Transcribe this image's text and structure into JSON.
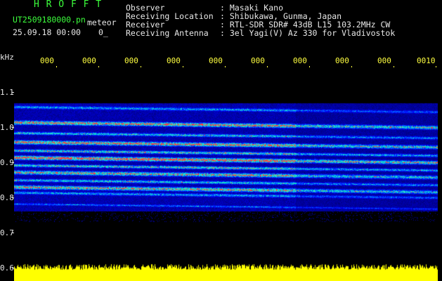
{
  "header": {
    "app_title": "H R O F F T",
    "filename": "UT2509180000.pn",
    "mode": "meteor",
    "datetime": "25.09.18 00:00",
    "status": "0_",
    "labels": {
      "observer": "Observer",
      "location": "Receiving Location",
      "receiver": "Receiver",
      "antenna": "Receiving Antenna"
    },
    "values": {
      "observer": ": Masaki Kano",
      "location": ": Shibukawa, Gunma, Japan",
      "receiver": ": RTL-SDR SDR# 43dB L15 103.2MHz CW",
      "antenna": ": 3el Yagi(V) Az 330 for Vladivostok"
    }
  },
  "axis": {
    "unit": "kHz",
    "y_ticks": [
      "1.1",
      "1.0",
      "0.9",
      "0.8",
      "0.7",
      "0.6"
    ],
    "x_ticks": [
      "000",
      "000",
      "000",
      "000",
      "000",
      "000",
      "000",
      "000",
      "000",
      "0010"
    ]
  },
  "colors": {
    "background": "#000000",
    "noise_floor": "#00008c",
    "signal_low": "#0064ff",
    "signal_mid": "#00ffc8",
    "signal_high": "#ff2828",
    "audio_band": "#ffff00"
  }
}
